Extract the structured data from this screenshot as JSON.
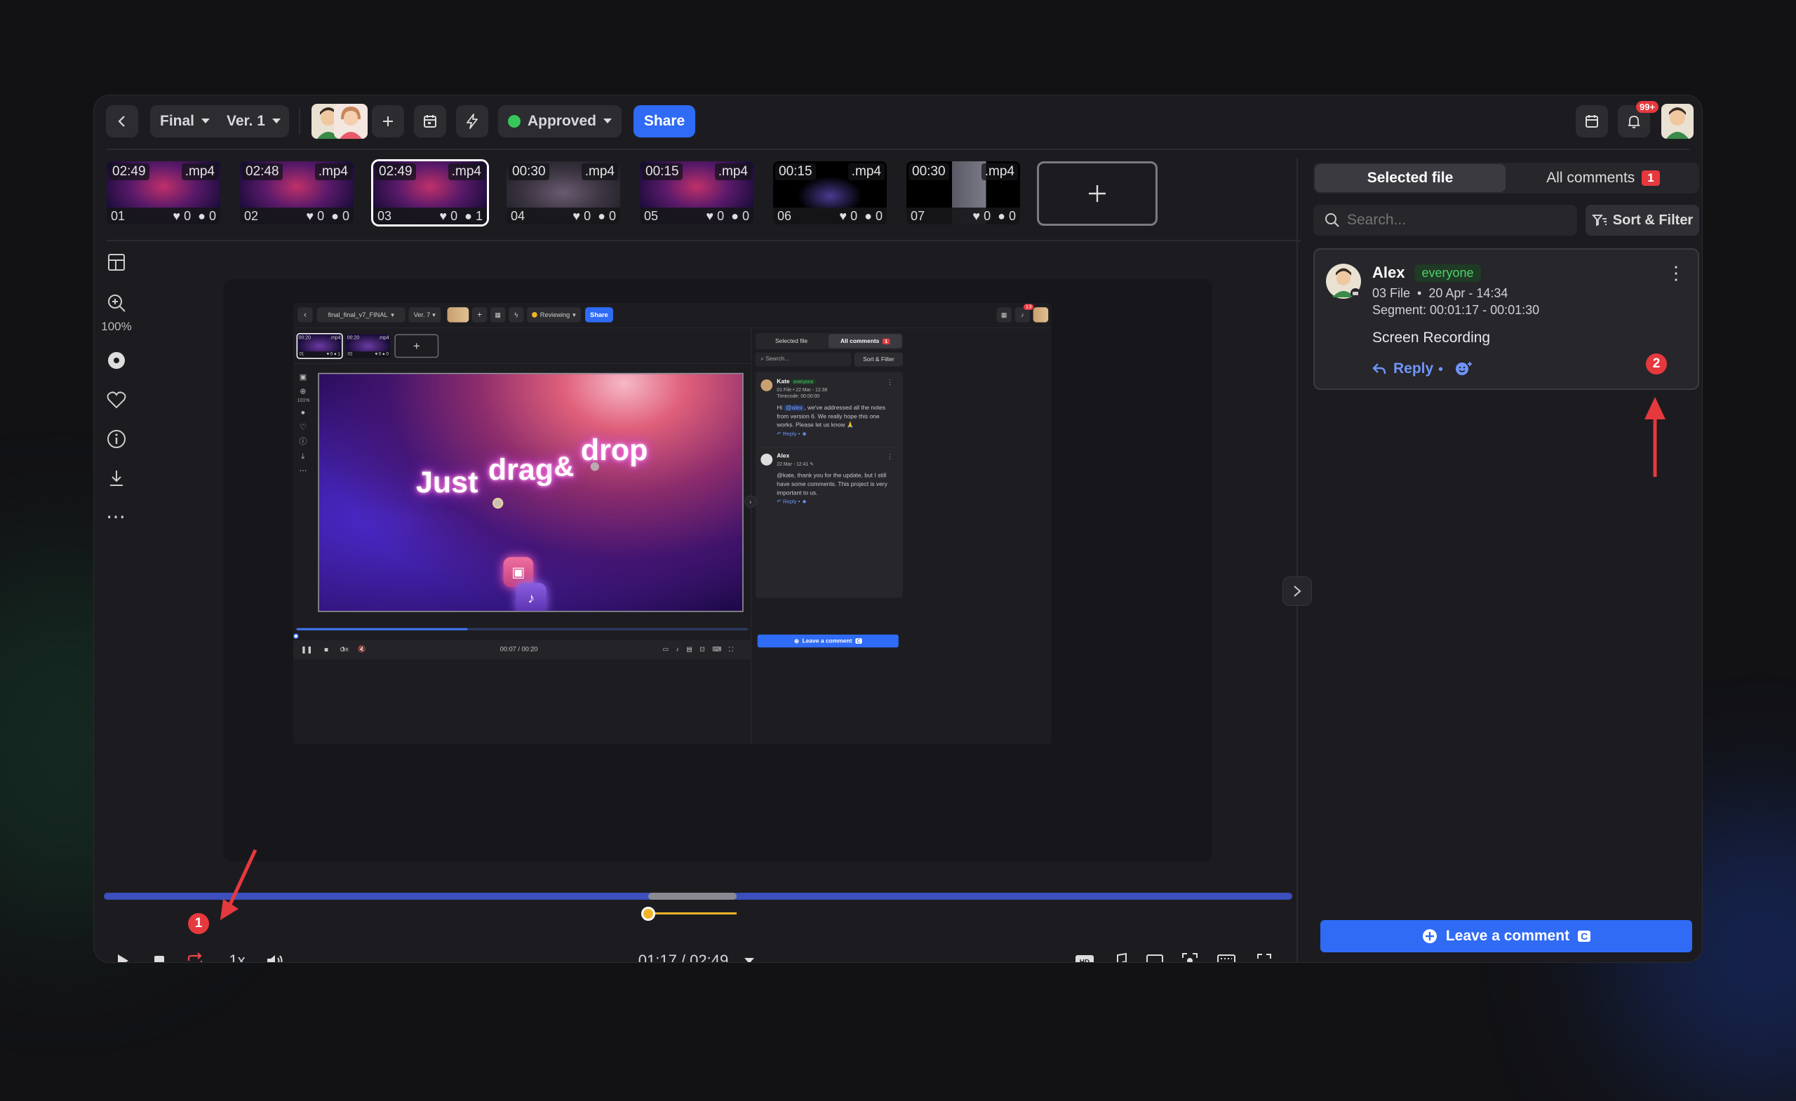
{
  "toolbar": {
    "version_label": "Final",
    "ver_label": "Ver. 1",
    "status_label": "Approved",
    "share_label": "Share",
    "notif_badge": "99+"
  },
  "thumbs": [
    {
      "dur": "02:49",
      "ext": ".mp4",
      "idx": "01",
      "likes": "0",
      "comments": "0"
    },
    {
      "dur": "02:48",
      "ext": ".mp4",
      "idx": "02",
      "likes": "0",
      "comments": "0"
    },
    {
      "dur": "02:49",
      "ext": ".mp4",
      "idx": "03",
      "likes": "0",
      "comments": "1"
    },
    {
      "dur": "00:30",
      "ext": ".mp4",
      "idx": "04",
      "likes": "0",
      "comments": "0"
    },
    {
      "dur": "00:15",
      "ext": ".mp4",
      "idx": "05",
      "likes": "0",
      "comments": "0"
    },
    {
      "dur": "00:15",
      "ext": ".mp4",
      "idx": "06",
      "likes": "0",
      "comments": "0"
    },
    {
      "dur": "00:30",
      "ext": ".mp4",
      "idx": "07",
      "likes": "0",
      "comments": "0"
    }
  ],
  "sidebar": {
    "zoom": "100%"
  },
  "inner": {
    "filename": "final_final_v7_FINAL",
    "ver": "Ver. 7",
    "status": "Reviewing",
    "share": "Share",
    "notif": "13",
    "thumbs": [
      {
        "dur": "00:20",
        "ext": ".mp4",
        "idx": "01",
        "likes": "0",
        "comments": "1"
      },
      {
        "dur": "00:20",
        "ext": ".mp4",
        "idx": "02",
        "likes": "0",
        "comments": "0"
      }
    ],
    "zoom": "101%",
    "hero_words": [
      "Just",
      "drag",
      "&",
      "drop"
    ],
    "tabs": {
      "selected": "Selected file",
      "all": "All comments",
      "count": "1"
    },
    "search_placeholder": "Search...",
    "sort_label": "Sort & Filter",
    "comments": [
      {
        "author": "Kate",
        "chip": "everyone",
        "meta": "01 File  •  22 Mar - 12:38",
        "timecode": "Timecode: 00:00:00",
        "text_pre": "Hi ",
        "mention": "@alex",
        "text_post": ", we've addressed all the notes from version 6. We really hope this one works. Please let us know 🙏",
        "reply": "Reply"
      },
      {
        "author": "Alex",
        "meta": "22 Mar - 12:41 ✎",
        "text": "@kate, thank you for the update, but I still have some comments. This project is very important to us.",
        "reply": "Reply"
      }
    ],
    "time": "00:07 / 00:20",
    "speed": "1x",
    "leave": "Leave a comment",
    "leave_key": "C"
  },
  "player": {
    "speed": "1x",
    "time": "01:17 / 02:49",
    "progress": 0.46,
    "segment_start": 0.4578,
    "segment_end": 0.5325,
    "badge_1": "1"
  },
  "comments": {
    "tab_selected": "Selected file",
    "tab_all": "All comments",
    "tab_all_count": "1",
    "search_placeholder": "Search...",
    "sort_label": "Sort & Filter",
    "items": [
      {
        "author": "Alex",
        "chip": "everyone",
        "file": "03 File",
        "date": "20 Apr - 14:34",
        "segment": "Segment: 00:01:17 - 00:01:30",
        "text": "Screen Recording",
        "reply": "Reply",
        "badge": "2"
      }
    ],
    "leave_label": "Leave a comment",
    "leave_key": "C"
  },
  "colors": {
    "accent": "#2f6bf5",
    "approved": "#37c659",
    "reviewing": "#f0b428",
    "badge": "#e5393e"
  }
}
